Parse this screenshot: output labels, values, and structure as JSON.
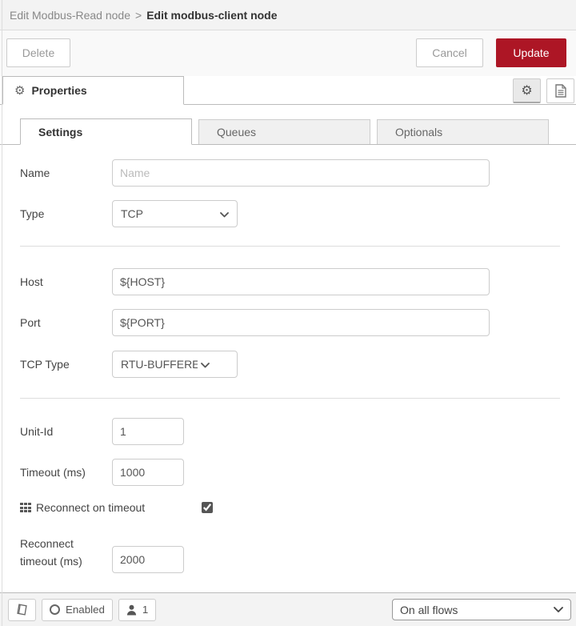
{
  "header": {
    "breadcrumb_parent": "Edit Modbus-Read node",
    "breadcrumb_separator": ">",
    "breadcrumb_current": "Edit modbus-client node"
  },
  "toolbar": {
    "delete": "Delete",
    "cancel": "Cancel",
    "update": "Update"
  },
  "properties_bar": {
    "title": "Properties",
    "gear_glyph": "⚙"
  },
  "tabs": {
    "settings": "Settings",
    "queues": "Queues",
    "optionals": "Optionals",
    "active": "Settings"
  },
  "form": {
    "name": {
      "label": "Name",
      "placeholder": "Name",
      "value": ""
    },
    "type": {
      "label": "Type",
      "value": "TCP"
    },
    "host": {
      "label": "Host",
      "value": "${HOST}"
    },
    "port": {
      "label": "Port",
      "value": "${PORT}"
    },
    "tcp_type": {
      "label": "TCP Type",
      "value": "RTU-BUFFERED"
    },
    "unit_id": {
      "label": "Unit-Id",
      "value": "1"
    },
    "timeout_ms": {
      "label": "Timeout (ms)",
      "value": "1000"
    },
    "reconnect_on_timeout": {
      "label": "Reconnect on timeout",
      "checked": true
    },
    "reconnect_timeout_ms": {
      "label": "Reconnect timeout (ms)",
      "value": "2000"
    }
  },
  "footer": {
    "enabled": "Enabled",
    "instance_count": "1",
    "deploy_scope": "On all flows"
  },
  "colors": {
    "accent_red": "#AD1625",
    "header_bg": "#f3f3f3",
    "tab_inactive_bg": "#f0f0f0",
    "border": "#cccccc"
  }
}
